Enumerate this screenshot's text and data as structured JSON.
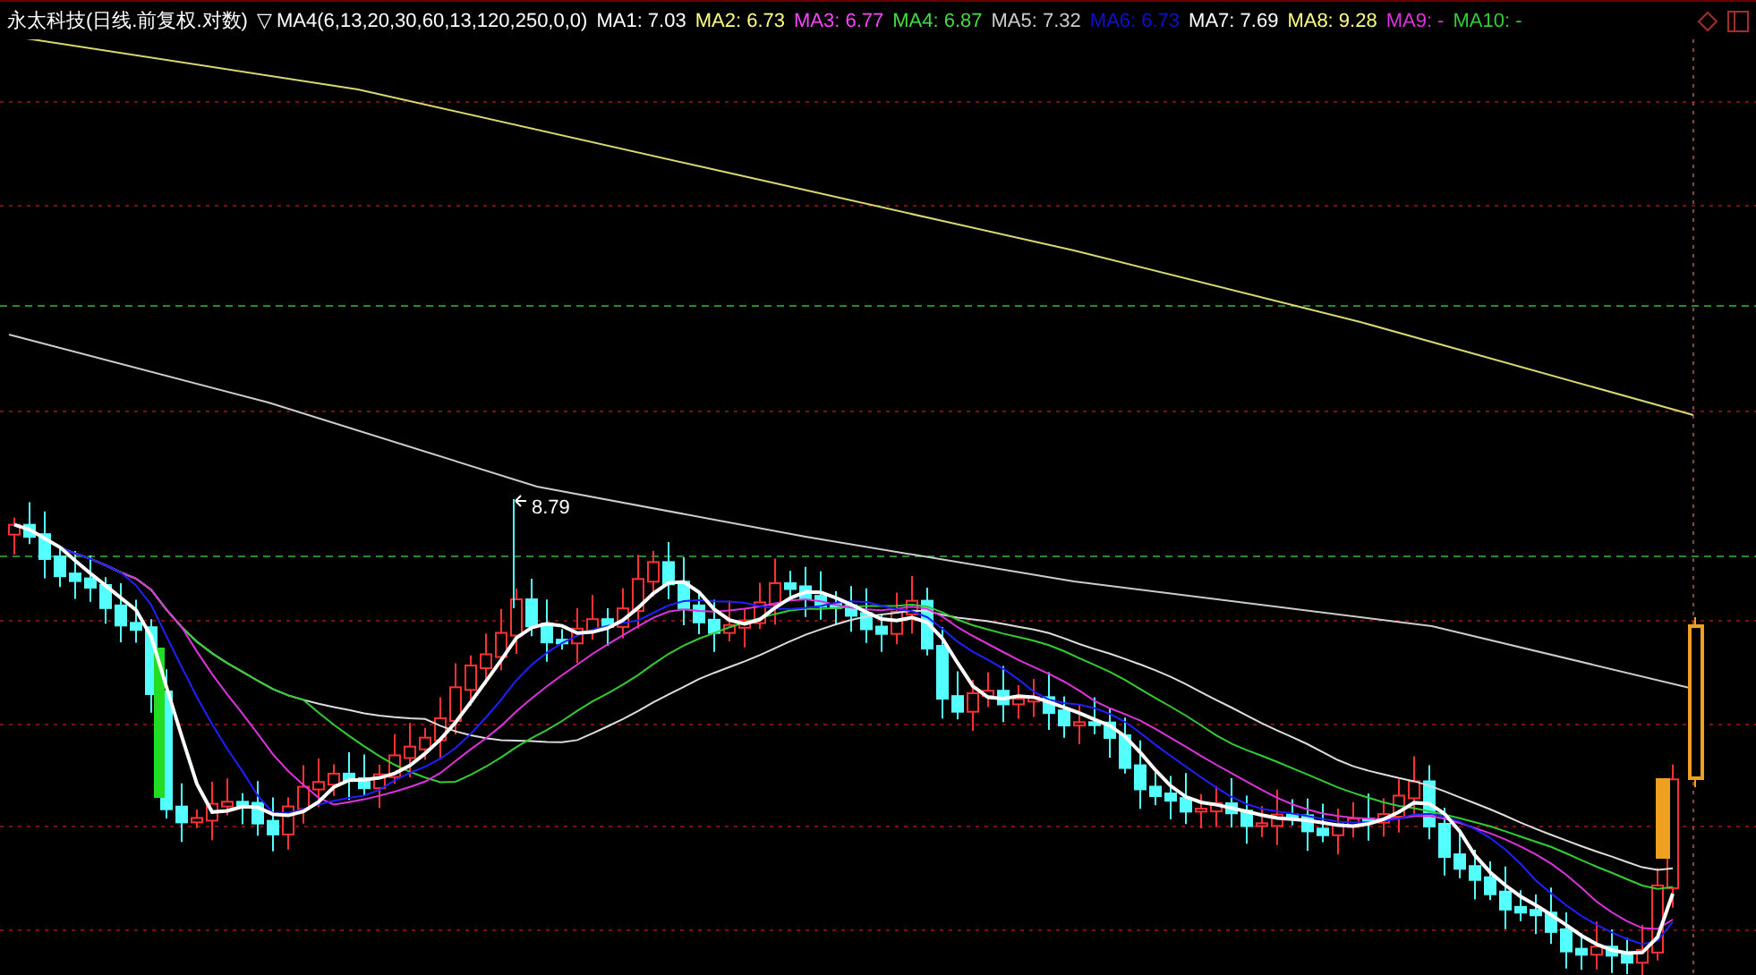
{
  "header": {
    "title": "永太科技(日线.前复权.对数)",
    "indicator": "▽ MA4(6,13,20,30,60,13,120,250,0,0)",
    "legend": [
      {
        "label": "MA1: 7.03",
        "color": "#ffffff"
      },
      {
        "label": "MA2: 6.73",
        "color": "#ffff80"
      },
      {
        "label": "MA3: 6.77",
        "color": "#ff44ff"
      },
      {
        "label": "MA4: 6.87",
        "color": "#44dd44"
      },
      {
        "label": "MA5: 7.32",
        "color": "#cccccc"
      },
      {
        "label": "MA6: 6.73",
        "color": "#1010d0"
      },
      {
        "label": "MA7: 7.69",
        "color": "#ffffff"
      },
      {
        "label": "MA8: 9.28",
        "color": "#ffff80"
      },
      {
        "label": "MA9: -",
        "color": "#dd33dd"
      },
      {
        "label": "MA10: -",
        "color": "#33cc33"
      }
    ]
  },
  "chart": {
    "high_label": "8.79"
  }
}
